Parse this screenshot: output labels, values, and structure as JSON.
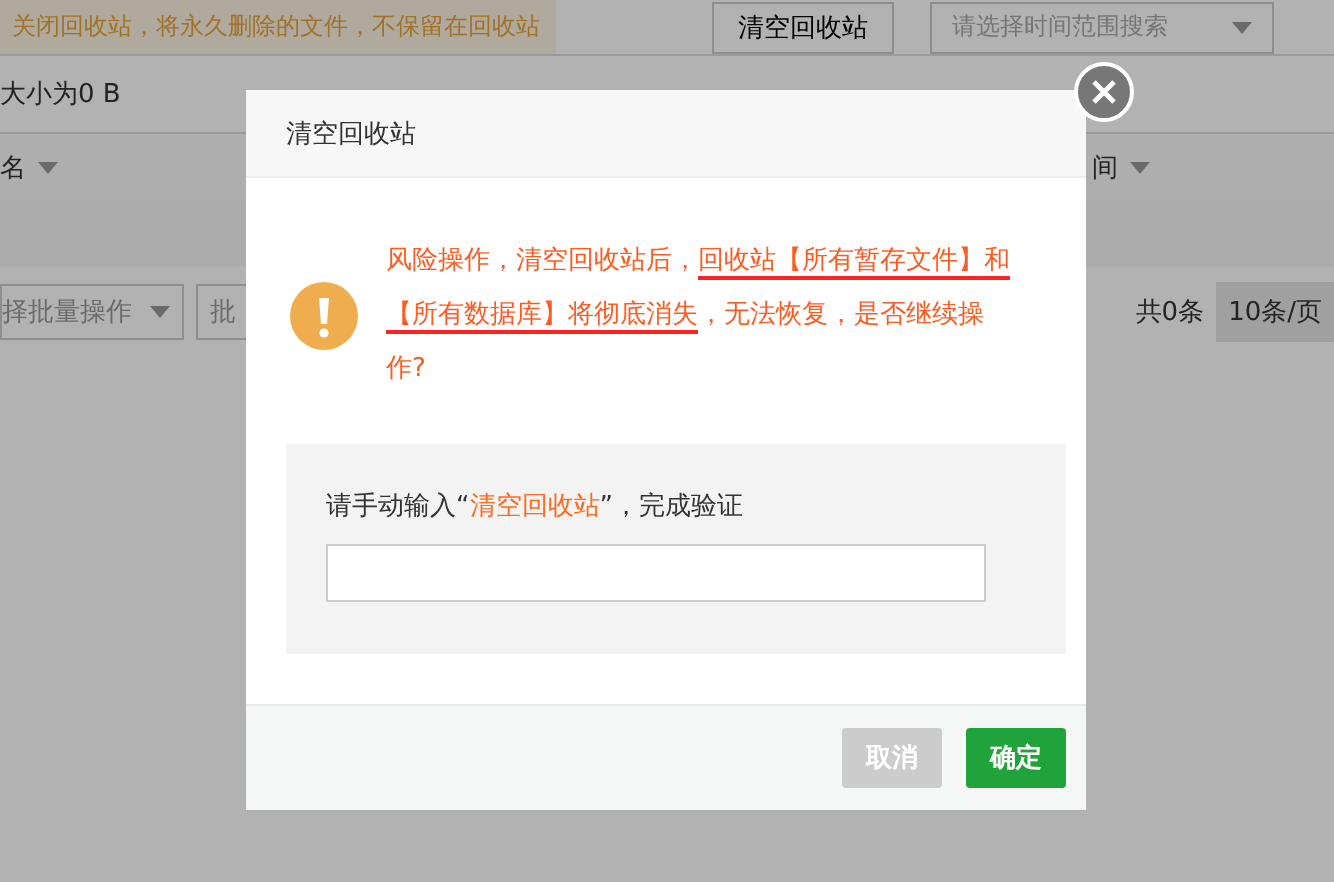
{
  "background": {
    "banner": "关闭回收站，将永久删除的文件，不保留在回收站",
    "clear_button": "清空回收站",
    "time_select": {
      "placeholder": "请选择时间范围搜索"
    },
    "size_info": "大小为0 B",
    "columns": [
      "名",
      "间"
    ],
    "batch_select": "择批量操作",
    "batch_button": "批",
    "total": "共0条",
    "page_size": "10条/页"
  },
  "dialog": {
    "title": "清空回收站",
    "message": [
      {
        "text": "风险操作，清空回收站后，",
        "underlined": false
      },
      {
        "text": "回收站【所有暂存文件】和【所有数据库】将彻底消失",
        "underlined": true
      },
      {
        "text": "，无法恢复，是否继续操作?",
        "underlined": false
      }
    ],
    "prompt": [
      {
        "text": "请手动输入“",
        "highlighted": false
      },
      {
        "text": "清空回收站",
        "highlighted": true
      },
      {
        "text": "”，完成验证",
        "highlighted": false
      }
    ],
    "buttons": [
      {
        "label": "取消",
        "kind": "cancel",
        "disabled": true
      },
      {
        "label": "确定",
        "kind": "confirm",
        "disabled": false
      }
    ]
  }
}
